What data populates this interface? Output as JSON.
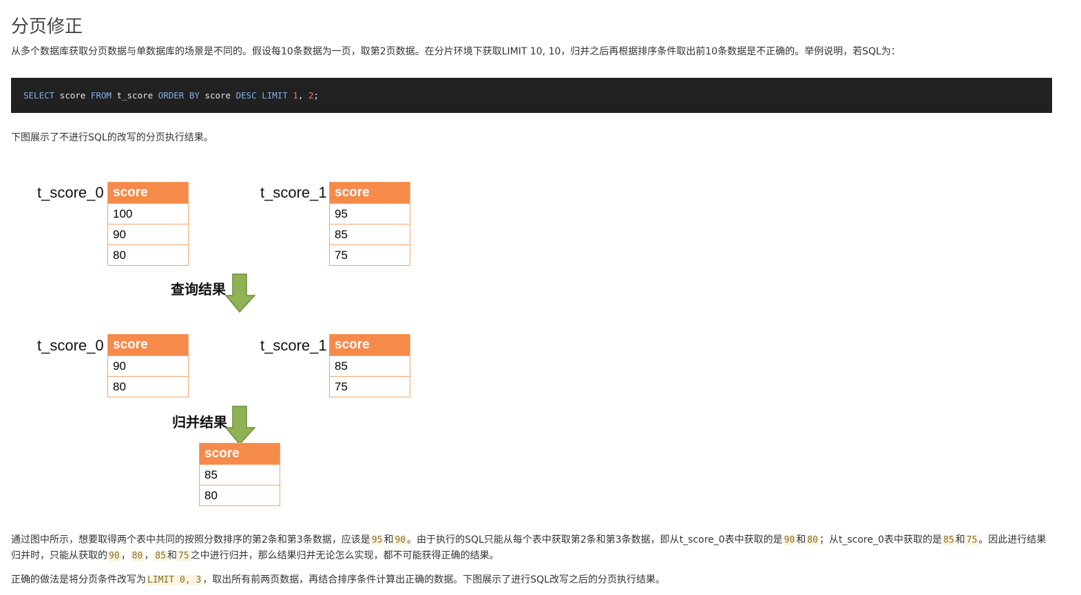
{
  "title": "分页修正",
  "intro": "从多个数据库获取分页数据与单数据库的场景是不同的。假设每10条数据为一页，取第2页数据。在分片环境下获取LIMIT 10, 10，归并之后再根据排序条件取出前10条数据是不正确的。举例说明，若SQL为：",
  "code": {
    "t1": "SELECT",
    "t2": " score ",
    "t3": "FROM",
    "t4": " t_score ",
    "t5": "ORDER BY",
    "t6": " score ",
    "t7": "DESC",
    "t8": " ",
    "t9": "LIMIT",
    "t10": " ",
    "t11": "1",
    "t12": ", ",
    "t13": "2",
    "t14": ";"
  },
  "caption1": "下图展示了不进行SQL的改写的分页执行结果。",
  "diagram": {
    "top": [
      {
        "name": "t_score_0",
        "header": "score",
        "rows": [
          "100",
          "90",
          "80"
        ]
      },
      {
        "name": "t_score_1",
        "header": "score",
        "rows": [
          "95",
          "85",
          "75"
        ]
      }
    ],
    "step1": "查询结果",
    "middle": [
      {
        "name": "t_score_0",
        "header": "score",
        "rows": [
          "90",
          "80"
        ]
      },
      {
        "name": "t_score_1",
        "header": "score",
        "rows": [
          "85",
          "75"
        ]
      }
    ],
    "step2": "归并结果",
    "result": {
      "header": "score",
      "rows": [
        "85",
        "80"
      ]
    },
    "arrow_color": "#7fa34a"
  },
  "explain": {
    "a": "通过图中所示，想要取得两个表中共同的按照分数排序的第2条和第3条数据，应该是",
    "c1": "95",
    "b": "和",
    "c2": "90",
    "d": "。由于执行的SQL只能从每个表中获取第2条和第3条数据，即从t_score_0表中获取的是",
    "c3": "90",
    "e": "和",
    "c4": "80",
    "f": "；从t_score_0表中获取的是",
    "c5": "85",
    "g": "和",
    "c6": "75",
    "h": "。因此进行结果归并时，只能从获取的",
    "c7": "90",
    "i": "，",
    "c8": "80",
    "j": "，",
    "c9": "85",
    "k": "和",
    "c10": "75",
    "l": "之中进行归并，那么结果归并无论怎么实现，都不可能获得正确的结果。"
  },
  "final": {
    "a": "正确的做法是将分页条件改写为",
    "code": "LIMIT 0, 3",
    "b": "，取出所有前两页数据，再结合排序条件计算出正确的数据。下图展示了进行SQL改写之后的分页执行结果。"
  }
}
